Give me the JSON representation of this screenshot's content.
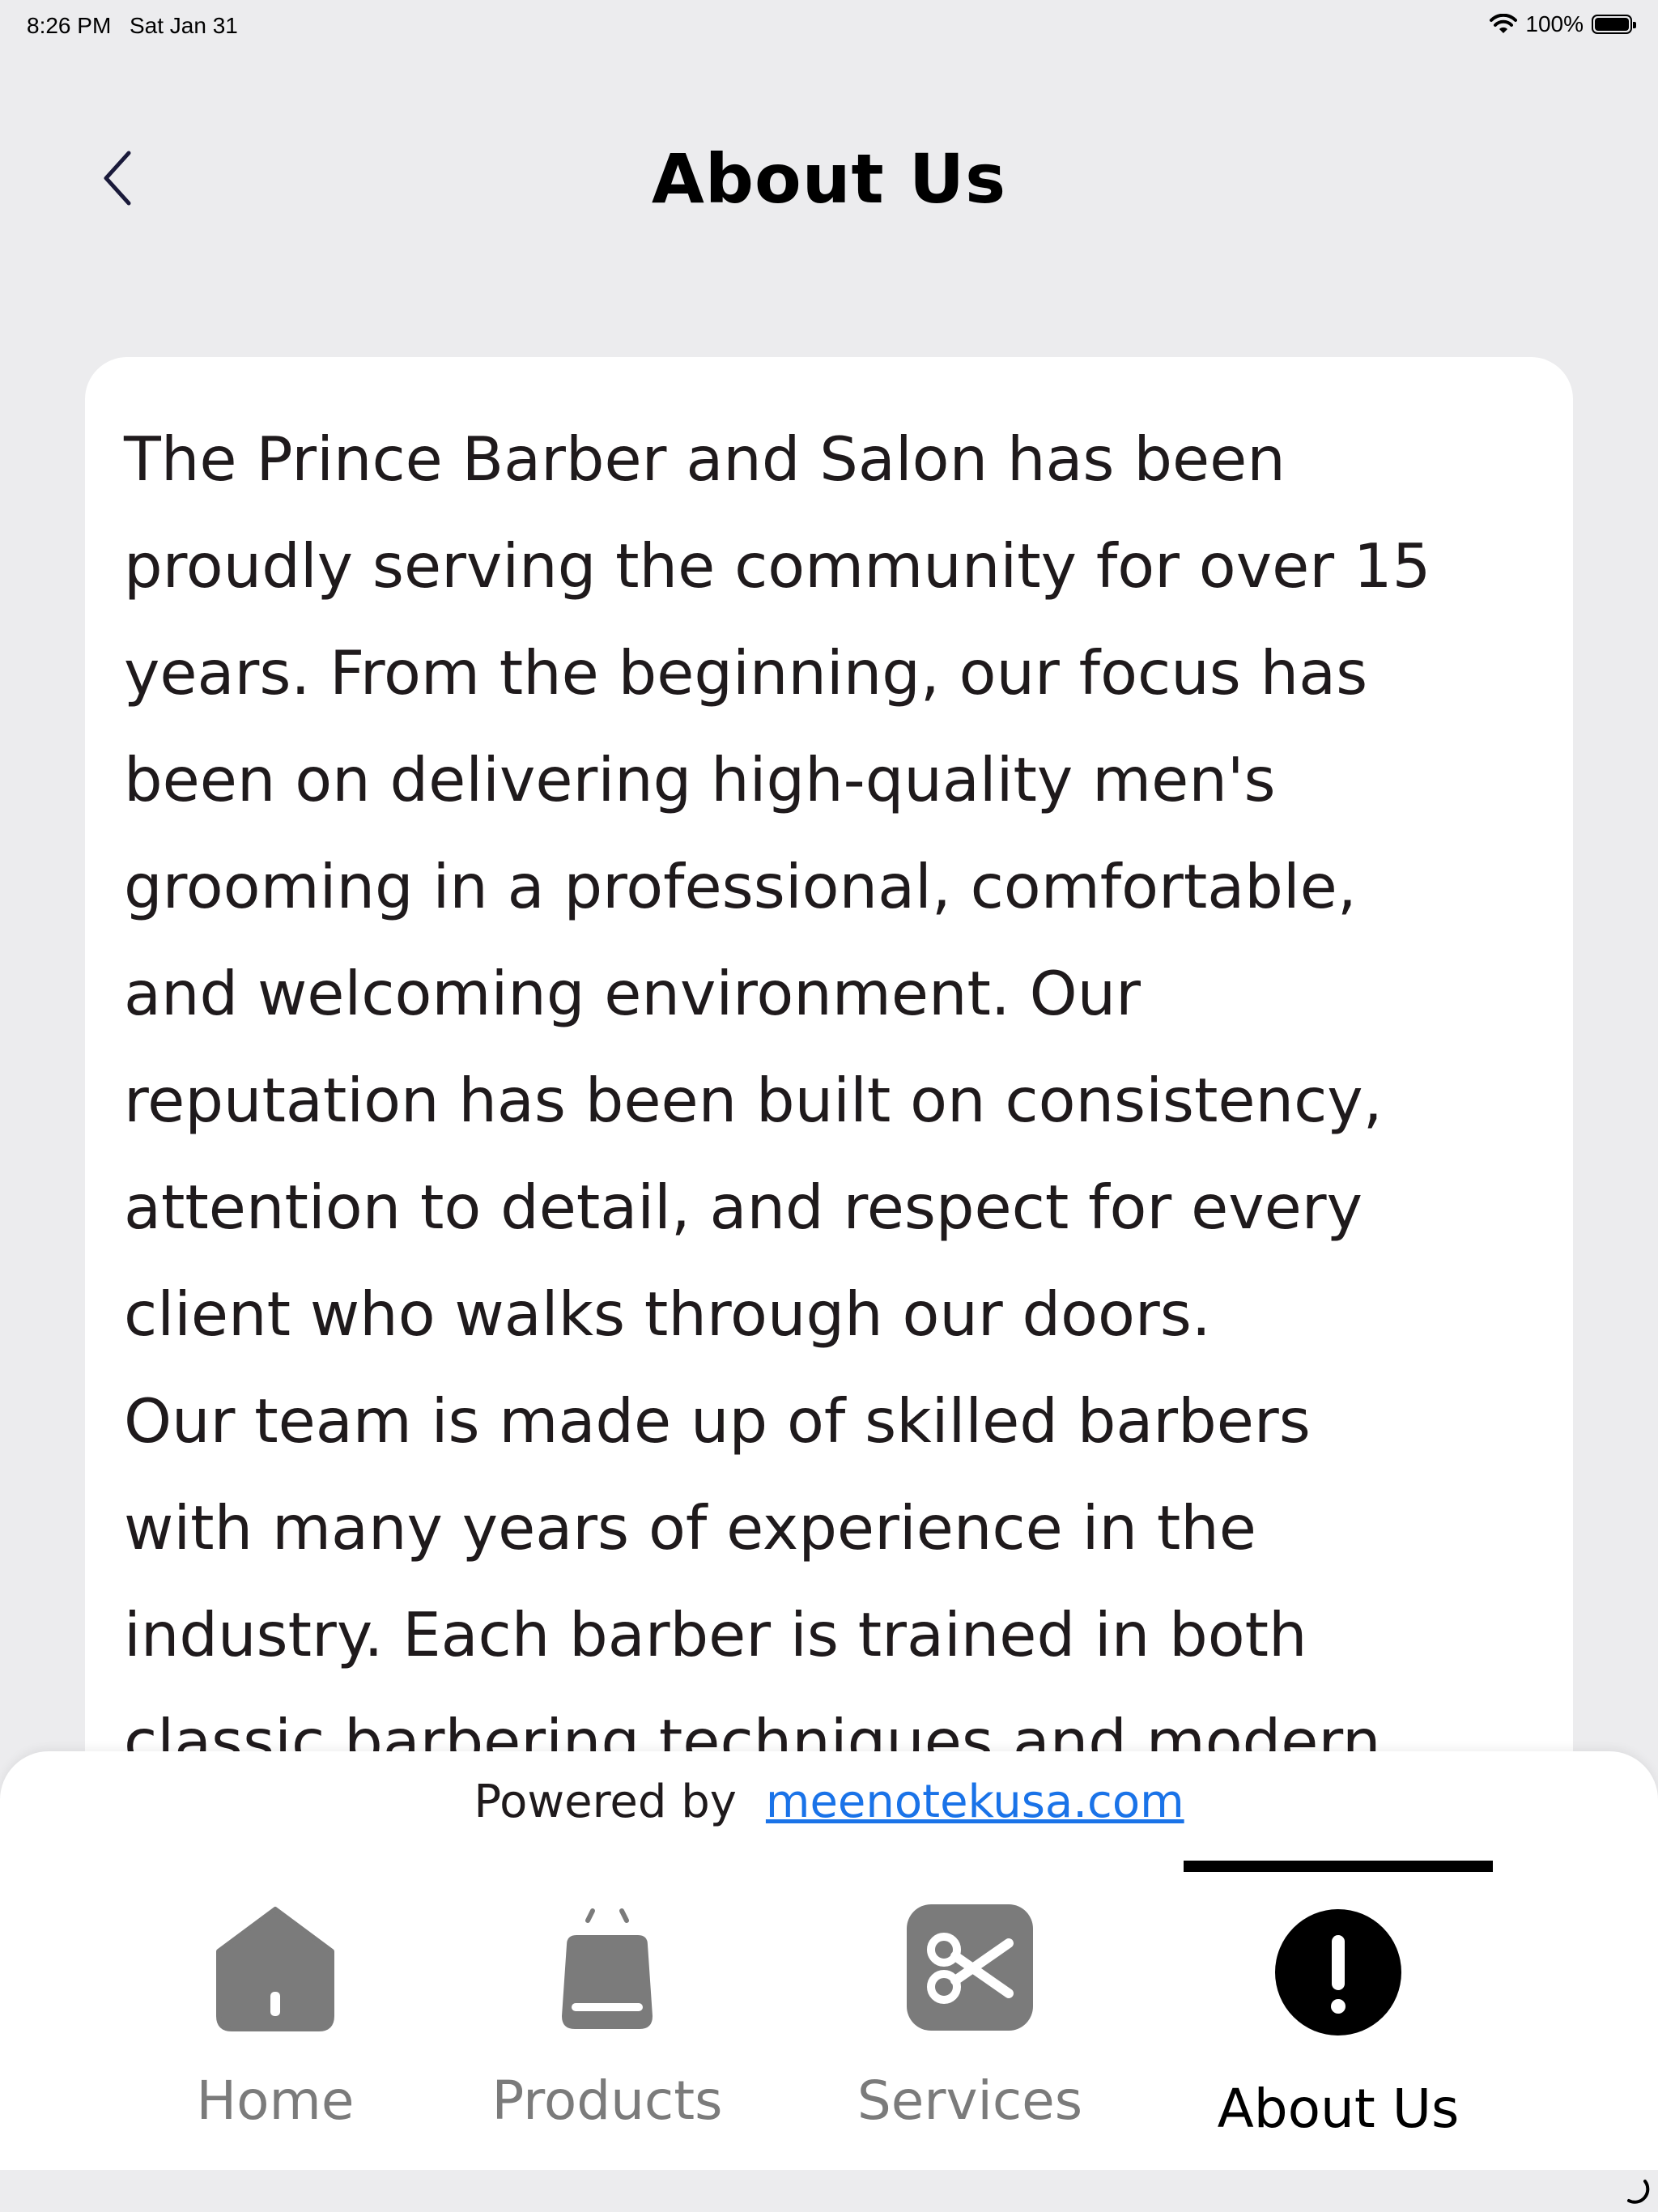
{
  "status_bar": {
    "time": "8:26 PM",
    "date": "Sat Jan 31",
    "battery": "100%",
    "icons": [
      "wifi-icon",
      "battery-icon"
    ]
  },
  "header": {
    "title": "About Us",
    "back_icon": "chevron-left-icon"
  },
  "content": {
    "text": "The Prince Barber and Salon has been\nproudly serving the community for over 15\nyears. From the beginning, our focus has\nbeen on delivering high-quality men's\ngrooming in a professional, comfortable,\nand welcoming environment. Our\nreputation has been built on consistency,\nattention to detail, and respect for every\nclient who walks through our doors.\nOur team is made up of skilled barbers\nwith many years of experience in the\nindustry. Each barber is trained in both\nclassic barbering techniques and modern"
  },
  "footer": {
    "powered_label": "Powered by",
    "powered_link": "meenotekusa.com"
  },
  "tabs": [
    {
      "label": "Home",
      "icon": "home-icon",
      "active": false
    },
    {
      "label": "Products",
      "icon": "shopping-bag-icon",
      "active": false
    },
    {
      "label": "Services",
      "icon": "scissors-icon",
      "active": false
    },
    {
      "label": "About Us",
      "icon": "info-icon",
      "active": true
    }
  ],
  "colors": {
    "background": "#ececee",
    "card": "#ffffff",
    "text": "#1f1a1c",
    "link": "#1a73e8",
    "inactive_icon": "#7b7b7b",
    "active": "#000000"
  }
}
